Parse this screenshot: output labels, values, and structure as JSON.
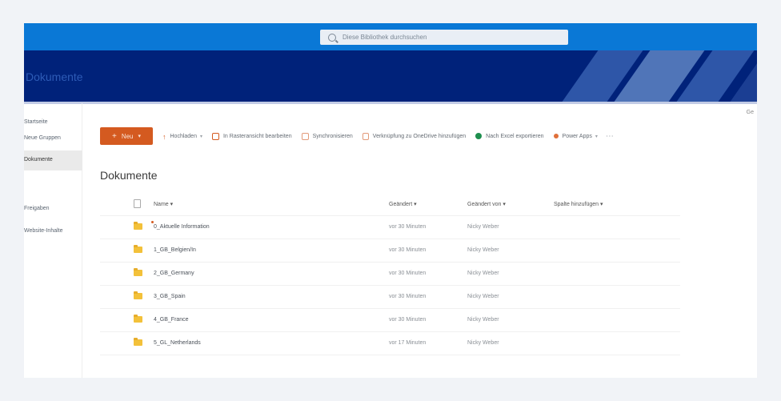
{
  "search": {
    "placeholder": "Diese Bibliothek durchsuchen"
  },
  "site": {
    "title": "Dokumente"
  },
  "corner": {
    "label": "Ge"
  },
  "nav": {
    "selected": "Dokumente",
    "items": [
      "Startseite",
      "Neue Gruppen",
      "Freigaben",
      "Website-Inhalte"
    ]
  },
  "commands": {
    "new_label": "Neu",
    "upload": "Hochladen",
    "edit_grid": "In Rasteransicht bearbeiten",
    "sync": "Synchronisieren",
    "shortcut": "Verknüpfung zu OneDrive hinzufügen",
    "export": "Nach Excel exportieren",
    "flow": "Power Apps"
  },
  "library": {
    "title": "Dokumente",
    "headers": {
      "name": "Name",
      "modified": "Geändert",
      "modified_by": "Geändert von",
      "add_column": "Spalte hinzufügen"
    },
    "rows": [
      {
        "name": "0_Aktuelle Information",
        "modified": "vor 30 Minuten",
        "by": "Nicky Weber"
      },
      {
        "name": "1_GB_Belgien/In",
        "modified": "vor 30 Minuten",
        "by": "Nicky Weber"
      },
      {
        "name": "2_GB_Germany",
        "modified": "vor 30 Minuten",
        "by": "Nicky Weber"
      },
      {
        "name": "3_GB_Spain",
        "modified": "vor 30 Minuten",
        "by": "Nicky Weber"
      },
      {
        "name": "4_GB_France",
        "modified": "vor 30 Minuten",
        "by": "Nicky Weber"
      },
      {
        "name": "5_GL_Netherlands",
        "modified": "vor 17 Minuten",
        "by": "Nicky Weber"
      }
    ]
  },
  "colors": {
    "accent": "#d45a20",
    "topbar": "#0a78d6",
    "banner": "#00227a",
    "folder": "#f3c13a"
  }
}
